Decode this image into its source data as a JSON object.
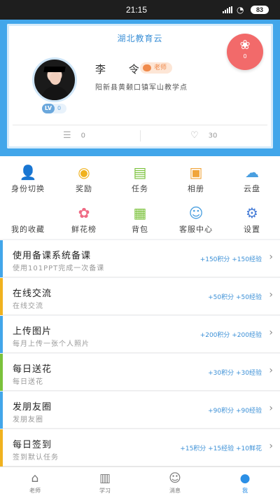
{
  "status_bar": {
    "time": "21:15",
    "battery": "83"
  },
  "profile": {
    "app_title": "湖北教育云",
    "name": "李 令",
    "role": "老师",
    "school": "阳新县黄颡口镇军山教学点",
    "level_badge": "LV",
    "level_value": "0",
    "flower_count": "0",
    "stat_left_value": "0",
    "stat_right_value": "30",
    "accent_color": "#42a6ea"
  },
  "grid": {
    "items": [
      {
        "label": "身份切换",
        "icon": "user-switch-icon",
        "color": "#f0b21f"
      },
      {
        "label": "奖励",
        "icon": "medal-icon",
        "color": "#f0b21f"
      },
      {
        "label": "任务",
        "icon": "task-icon",
        "color": "#7bc23b"
      },
      {
        "label": "相册",
        "icon": "album-icon",
        "color": "#f0a53b"
      },
      {
        "label": "云盘",
        "icon": "cloud-icon",
        "color": "#4a9fe0"
      },
      {
        "label": "我的收藏",
        "icon": "star-icon",
        "color": "#ffffff"
      },
      {
        "label": "鲜花榜",
        "icon": "flower-icon",
        "color": "#ef6a84"
      },
      {
        "label": "背包",
        "icon": "backpack-icon",
        "color": "#7bc23b"
      },
      {
        "label": "客服中心",
        "icon": "headset-icon",
        "color": "#4a9fe0"
      },
      {
        "label": "设置",
        "icon": "gear-icon",
        "color": "#4a7fd8"
      }
    ]
  },
  "tasks": [
    {
      "title": "使用备课系统备课",
      "subtitle": "使用101PPT完成一次备课",
      "reward": "+150积分 +150经验",
      "color": "#42a6ea"
    },
    {
      "title": "在线交流",
      "subtitle": "在线交流",
      "reward": "+50积分 +50经验",
      "color": "#f0b21f"
    },
    {
      "title": "上传图片",
      "subtitle": "每月上传一张个人照片",
      "reward": "+200积分 +200经验",
      "color": "#42a6ea"
    },
    {
      "title": "每日送花",
      "subtitle": "每日送花",
      "reward": "+30积分 +30经验",
      "color": "#7bc23b"
    },
    {
      "title": "发朋友圈",
      "subtitle": "发朋友圈",
      "reward": "+90积分 +90经验",
      "color": "#42a6ea"
    },
    {
      "title": "每日签到",
      "subtitle": "签到默认任务",
      "reward": "+15积分 +15经验 +10鲜花",
      "color": "#f0b21f"
    }
  ],
  "bottom_nav": [
    {
      "label": "老师",
      "icon": "home-icon"
    },
    {
      "label": "学习",
      "icon": "book-icon"
    },
    {
      "label": "消息",
      "icon": "message-icon"
    },
    {
      "label": "我",
      "icon": "person-icon"
    }
  ]
}
